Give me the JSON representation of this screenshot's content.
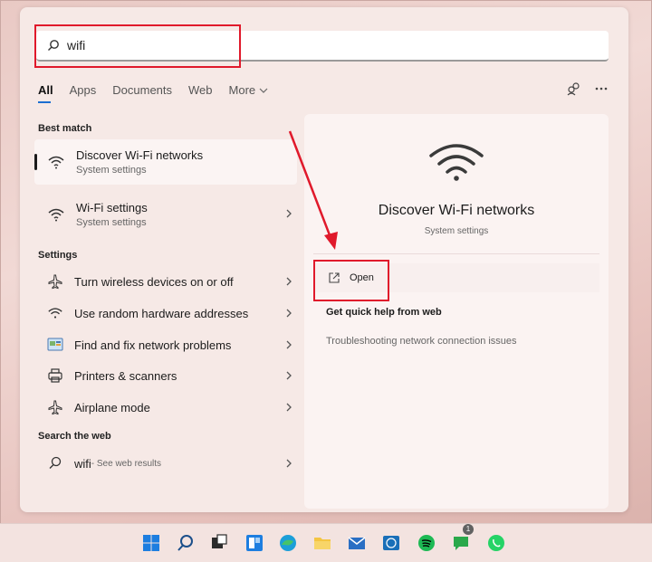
{
  "search": {
    "value": "wifi",
    "placeholder": ""
  },
  "tabs": [
    {
      "label": "All",
      "active": true
    },
    {
      "label": "Apps"
    },
    {
      "label": "Documents"
    },
    {
      "label": "Web"
    },
    {
      "label": "More",
      "icon": "chevron-down-icon"
    }
  ],
  "header_icons": [
    "account-switch-icon",
    "more-options-icon"
  ],
  "best_match": {
    "heading": "Best match",
    "items": [
      {
        "title": "Discover Wi-Fi networks",
        "subtitle": "System settings",
        "icon": "wifi-icon",
        "selected": true
      },
      {
        "title": "Wi-Fi settings",
        "subtitle": "System settings",
        "icon": "wifi-icon"
      }
    ]
  },
  "settings": {
    "heading": "Settings",
    "items": [
      {
        "label": "Turn wireless devices on or off",
        "icon": "airplane-icon"
      },
      {
        "label": "Use random hardware addresses",
        "icon": "wifi-icon"
      },
      {
        "label": "Find and fix network problems",
        "icon": "troubleshoot-icon"
      },
      {
        "label": "Printers & scanners",
        "icon": "printer-icon"
      },
      {
        "label": "Airplane mode",
        "icon": "airplane-icon"
      }
    ]
  },
  "web": {
    "heading": "Search the web",
    "query": "wifi",
    "suffix": " - See web results"
  },
  "preview": {
    "title": "Discover Wi-Fi networks",
    "subtitle": "System settings",
    "open_label": "Open",
    "quick_help_heading": "Get quick help from web",
    "quick_links": [
      "Troubleshooting network connection issues"
    ]
  },
  "taskbar": {
    "icons": [
      "windows-start-icon",
      "search-icon",
      "task-view-icon",
      "widgets-icon",
      "edge-icon",
      "file-explorer-icon",
      "mail-icon",
      "dell-icon",
      "spotify-icon",
      "messaging-icon",
      "whatsapp-icon"
    ],
    "messaging_badge": "1"
  },
  "colors": {
    "accent": "#1c6fd1",
    "callout": "#e0192b"
  }
}
